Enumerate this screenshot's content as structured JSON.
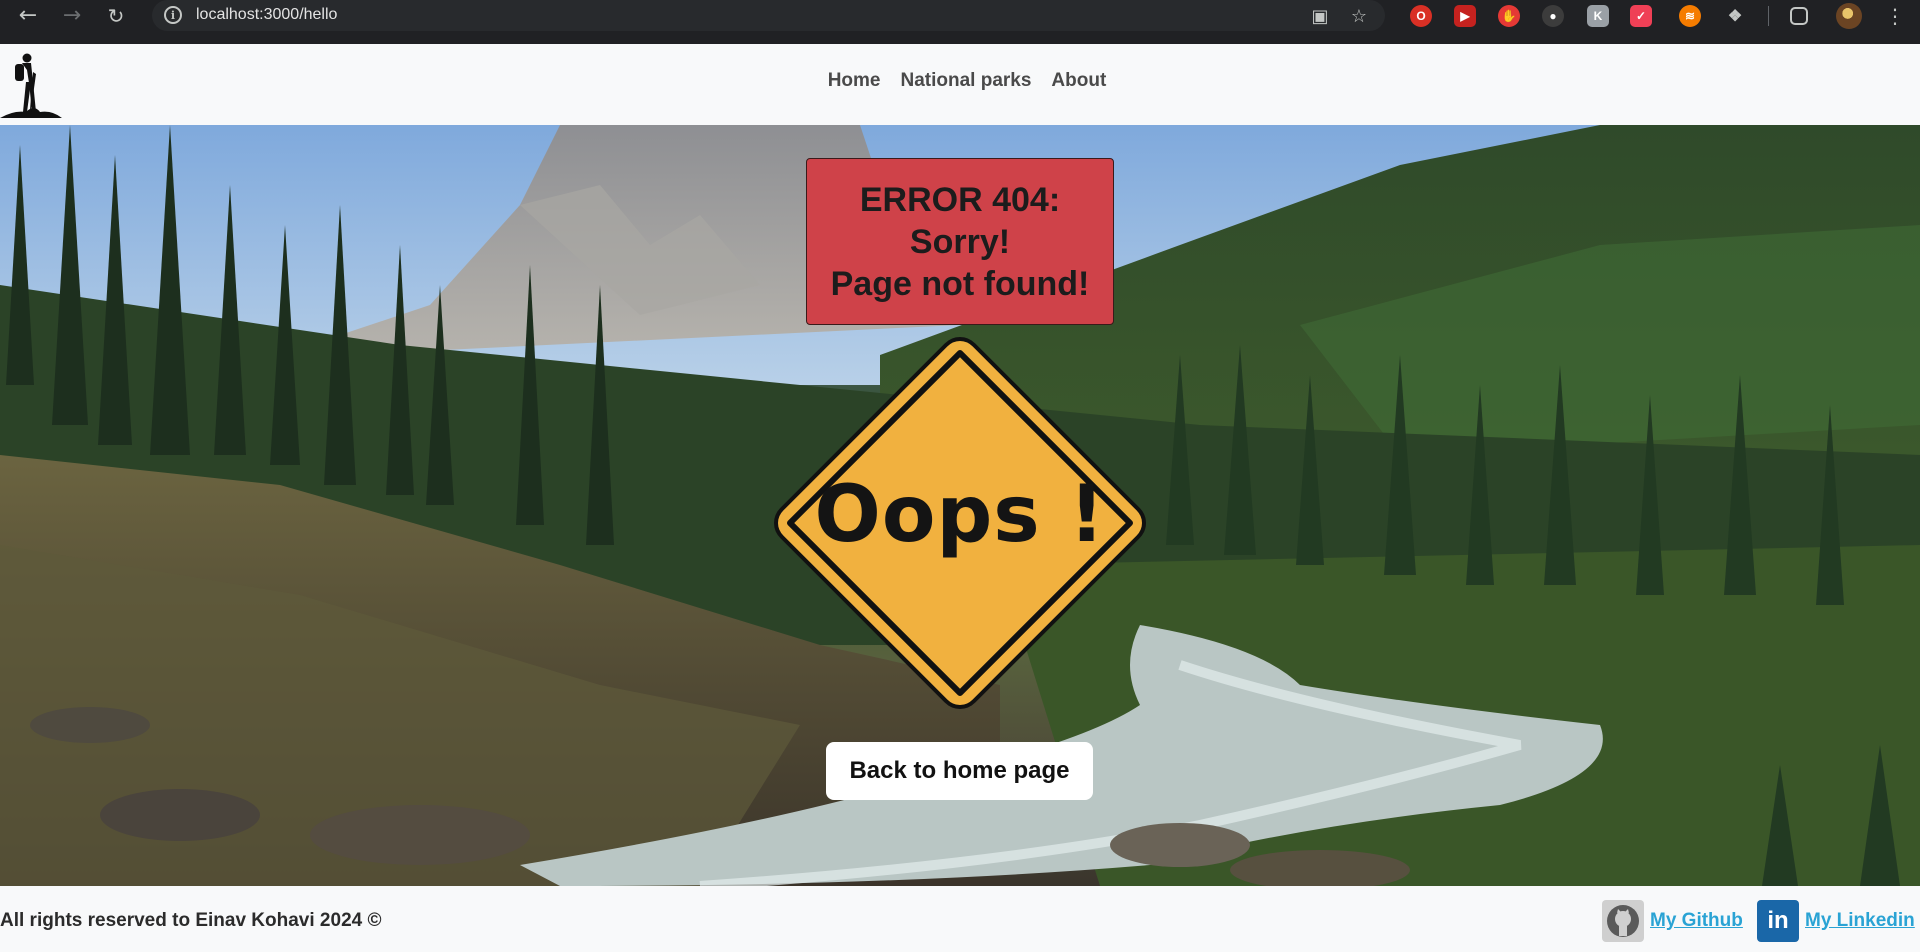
{
  "browser": {
    "url": "localhost:3000/hello",
    "extensions": [
      "opera-icon",
      "video-ext-icon",
      "hand-ext-icon",
      "ball-ext-icon",
      "k-ext-icon",
      "pocket-icon",
      "rss-icon",
      "puzzle-icon"
    ]
  },
  "navbar": {
    "links": [
      {
        "label": "Home"
      },
      {
        "label": "National parks"
      },
      {
        "label": "About"
      }
    ]
  },
  "error": {
    "line1": "ERROR 404:",
    "line2": "Sorry!",
    "line3": "Page not found!"
  },
  "sign": {
    "text": "Oops !",
    "fill": "#f1b13f"
  },
  "back_button": {
    "label": "Back to home page"
  },
  "footer": {
    "copyright": "All rights reserved to Einav Kohavi 2024 ©",
    "github_label": "My Github",
    "linkedin_label": "My Linkedin"
  },
  "colors": {
    "error_box": "#cf4249",
    "link": "#2aa3d4"
  }
}
